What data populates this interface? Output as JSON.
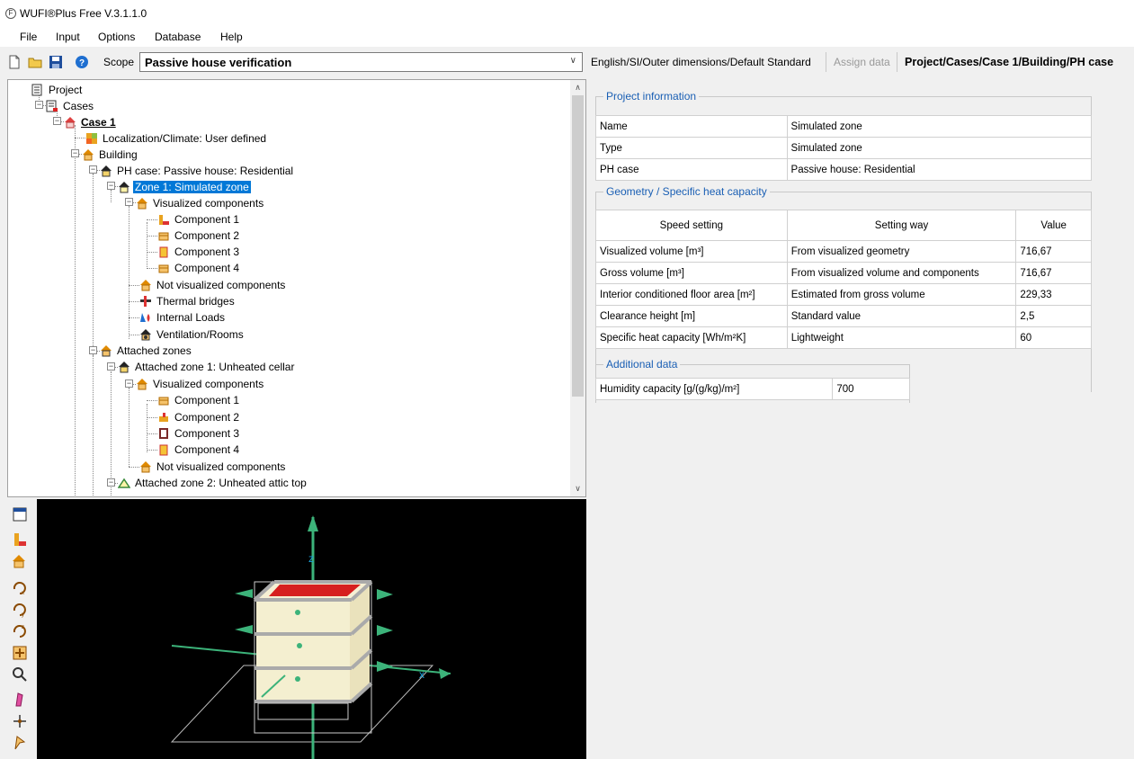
{
  "window": {
    "title": "WUFI®Plus Free V.3.1.1.0"
  },
  "menu": [
    "File",
    "Input",
    "Options",
    "Database",
    "Help"
  ],
  "toolbar": {
    "scope_label": "Scope",
    "scope_value": "Passive house verification",
    "units_label": "English/SI/Outer dimensions/Default Standard",
    "assign_label": "Assign data",
    "path_label": "Project/Cases/Case 1/Building/PH case"
  },
  "tree": [
    {
      "label": "Project",
      "icon": "project-icon"
    },
    {
      "label": "Cases",
      "icon": "cases-icon"
    },
    {
      "label": "Case 1",
      "icon": "case-icon"
    },
    {
      "label": "Localization/Climate: User defined",
      "icon": "climate-icon"
    },
    {
      "label": "Building",
      "icon": "building-icon"
    },
    {
      "label": "PH case: Passive house: Residential",
      "icon": "ph-case-icon"
    },
    {
      "label": "Zone 1: Simulated zone",
      "icon": "zone-icon"
    },
    {
      "label": "Visualized components",
      "icon": "components-icon"
    },
    {
      "label": "Component 1",
      "icon": "component-icon"
    },
    {
      "label": "Component 2",
      "icon": "component-icon"
    },
    {
      "label": "Component 3",
      "icon": "component-icon"
    },
    {
      "label": "Component 4",
      "icon": "component-icon"
    },
    {
      "label": "Not visualized components",
      "icon": "components-icon"
    },
    {
      "label": "Thermal bridges",
      "icon": "thermal-bridge-icon"
    },
    {
      "label": "Internal Loads",
      "icon": "internal-loads-icon"
    },
    {
      "label": "Ventilation/Rooms",
      "icon": "ventilation-icon"
    },
    {
      "label": "Attached zones",
      "icon": "attached-zones-icon"
    },
    {
      "label": "Attached zone 1: Unheated cellar",
      "icon": "attached-zone-icon"
    },
    {
      "label": "Visualized components",
      "icon": "components-icon"
    },
    {
      "label": "Component 1",
      "icon": "component-icon"
    },
    {
      "label": "Component 2",
      "icon": "component-icon"
    },
    {
      "label": "Component 3",
      "icon": "component-icon"
    },
    {
      "label": "Component 4",
      "icon": "component-icon"
    },
    {
      "label": "Not visualized components",
      "icon": "components-icon"
    },
    {
      "label": "Attached zone 2: Unheated attic top",
      "icon": "attic-icon"
    }
  ],
  "project_info": {
    "legend": "Project information",
    "rows": [
      [
        "Name",
        "Simulated zone"
      ],
      [
        "Type",
        "Simulated zone"
      ],
      [
        "PH case",
        "Passive house: Residential"
      ]
    ]
  },
  "geometry": {
    "legend": "Geometry / Specific heat capacity",
    "headers": [
      "Speed setting",
      "Setting way",
      "Value"
    ],
    "rows": [
      [
        "Visualized volume  [m³]",
        "From visualized geometry",
        "716,67"
      ],
      [
        "Gross volume  [m³]",
        "From visualized volume and components",
        "716,67"
      ],
      [
        "Interior conditioned floor area [m²]",
        "Estimated from gross volume",
        "229,33"
      ],
      [
        "Clearance height  [m]",
        "Standard value",
        "2,5"
      ],
      [
        "Specific heat capacity  [Wh/m²K]",
        "Lightweight",
        "60"
      ]
    ]
  },
  "additional": {
    "legend": "Additional data",
    "rows": [
      [
        "Humidity capacity  [g/(g/kg)/m²]",
        "700"
      ]
    ]
  },
  "viewer_tools": [
    "window-icon",
    "component-tool-icon",
    "building-tool-icon",
    "rotate-x-icon",
    "rotate-y-icon",
    "rotate-z-icon",
    "pan-icon",
    "zoom-icon",
    "pencil-icon",
    "axis-icon",
    "select-icon"
  ]
}
